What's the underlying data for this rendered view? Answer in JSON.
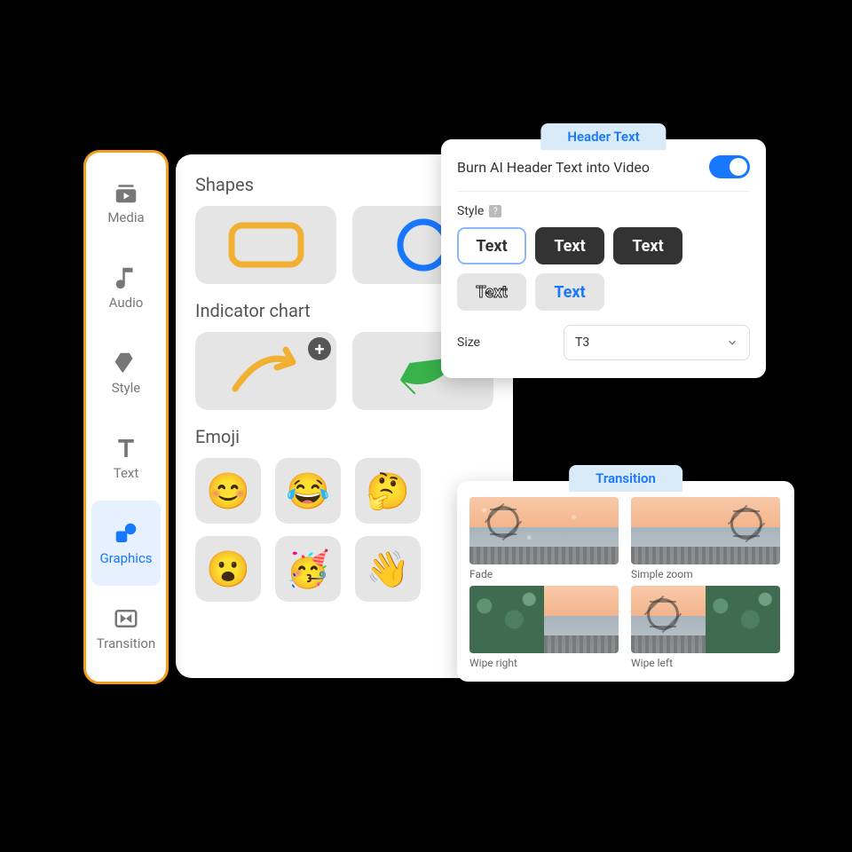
{
  "sidebar": {
    "items": [
      {
        "label": "Media",
        "icon": "media-icon"
      },
      {
        "label": "Audio",
        "icon": "music-icon"
      },
      {
        "label": "Style",
        "icon": "style-icon"
      },
      {
        "label": "Text",
        "icon": "text-icon"
      },
      {
        "label": "Graphics",
        "icon": "graphics-icon",
        "active": true
      },
      {
        "label": "Transition",
        "icon": "transition-icon"
      }
    ]
  },
  "graphics": {
    "sections": {
      "shapes": {
        "title": "Shapes"
      },
      "indicator": {
        "title": "Indicator chart"
      },
      "emoji": {
        "title": "Emoji"
      }
    },
    "emojis": [
      "😊",
      "😂",
      "🤔",
      "😮",
      "🥳",
      "👋"
    ]
  },
  "header_text": {
    "tab_label": "Header Text",
    "toggle_label": "Burn AI Header Text into Video",
    "toggle_on": true,
    "style_label": "Style",
    "style_options": [
      "Text",
      "Text",
      "Text",
      "Text",
      "Text"
    ],
    "size_label": "Size",
    "size_value": "T3"
  },
  "transition": {
    "tab_label": "Transition",
    "items": [
      {
        "label": "Fade"
      },
      {
        "label": "Simple zoom"
      },
      {
        "label": "Wipe right"
      },
      {
        "label": "Wipe left"
      }
    ]
  }
}
